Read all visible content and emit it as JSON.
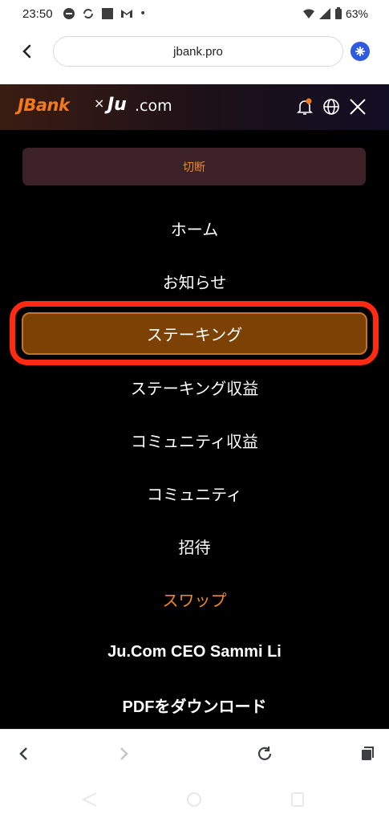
{
  "status_bar": {
    "time": "23:50",
    "battery": "63%",
    "dot": "•"
  },
  "browser": {
    "url": "jbank.pro"
  },
  "brand": {
    "partner_a": "JBank",
    "separator": "×",
    "partner_b_main": "Ju",
    "partner_b_suffix": ".com"
  },
  "menu": {
    "disconnect_label": "切断",
    "items": [
      {
        "label": "ホーム"
      },
      {
        "label": "お知らせ"
      },
      {
        "label": "ステーキング"
      },
      {
        "label": "ステーキング収益"
      },
      {
        "label": "コミュニティ収益"
      },
      {
        "label": "コミュニティ"
      },
      {
        "label": "招待"
      },
      {
        "label": "スワップ"
      },
      {
        "label": "Ju.Com CEO Sammi Li"
      },
      {
        "label": "PDFをダウンロード"
      }
    ]
  },
  "colors": {
    "accent_orange": "#f18a1d",
    "active_bg": "#7c4104",
    "highlight_ring": "#ff2a12"
  }
}
